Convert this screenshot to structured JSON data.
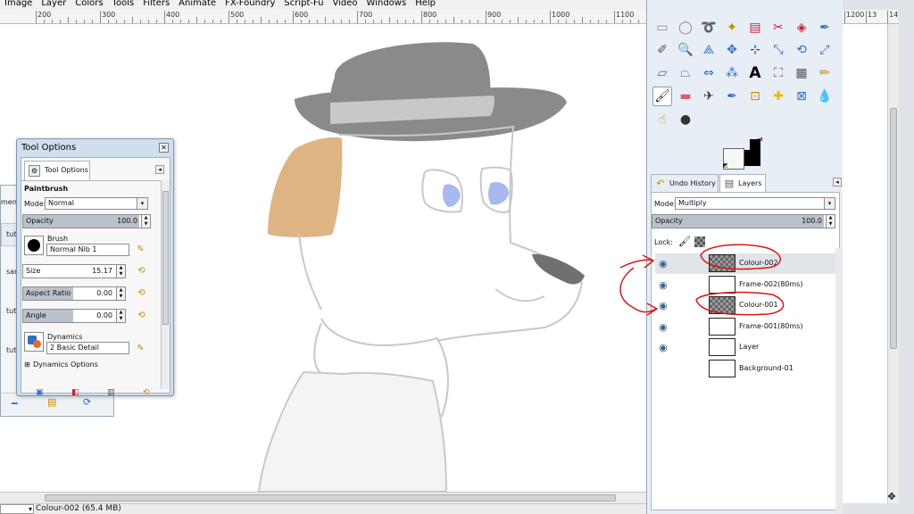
{
  "menu": [
    "Image",
    "Layer",
    "Colors",
    "Tools",
    "Filters",
    "Animate",
    "FX-Foundry",
    "Script-Fu",
    "Video",
    "Windows",
    "Help"
  ],
  "ruler": {
    "labels": [
      "200",
      "300",
      "400",
      "500",
      "600",
      "700",
      "800",
      "900",
      "1000",
      "1100"
    ]
  },
  "right_ruler": {
    "labels": [
      "1200",
      "13",
      "14"
    ]
  },
  "status": {
    "message": "Colour-002 (65.4 MB)"
  },
  "back_window": {
    "snippets": [
      "ment",
      "tuti",
      "san",
      "tuti",
      "tuti"
    ]
  },
  "tool_options": {
    "title": "Tool Options",
    "tab_label": "Tool Options",
    "tool_name": "Paintbrush",
    "mode_label": "Mode:",
    "mode_value": "Normal",
    "opacity_label": "Opacity",
    "opacity_value": "100.0",
    "brush_label": "Brush",
    "brush_value": "Normal Nib 1",
    "size_label": "Size",
    "size_value": "15.17",
    "aspect_label": "Aspect Ratio",
    "aspect_value": "0.00",
    "angle_label": "Angle",
    "angle_value": "0.00",
    "dynamics_label": "Dynamics",
    "dynamics_value": "2 Basic Detail",
    "dynamics_options_label": "Dynamics Options"
  },
  "dock": {
    "tab_undo": "Undo History",
    "tab_layers": "Layers",
    "mode_label": "Mode:",
    "mode_value": "Multiply",
    "opacity_label": "Opacity",
    "opacity_value": "100.0",
    "lock_label": "Lock:"
  },
  "layers": [
    {
      "name": "Colour-002",
      "thumb": "checker",
      "indent": true,
      "visible": true,
      "selected": true
    },
    {
      "name": "Frame-002(80ms)",
      "thumb": "white",
      "indent": true,
      "visible": true,
      "selected": false
    },
    {
      "name": "Colour-001",
      "thumb": "checker",
      "indent": true,
      "visible": true,
      "selected": false
    },
    {
      "name": "Frame-001(80ms)",
      "thumb": "white",
      "indent": true,
      "visible": true,
      "selected": false
    },
    {
      "name": "Layer",
      "thumb": "white",
      "indent": true,
      "visible": true,
      "selected": false
    },
    {
      "name": "Background-01",
      "thumb": "white",
      "indent": true,
      "visible": false,
      "selected": false
    }
  ],
  "colors": {
    "hat": "#8a8a8a",
    "hat_band": "#c8c8c8",
    "ear": "#deb485",
    "eye": "#a9b8ef",
    "nose": "#707070",
    "annotation": "#d21a1a",
    "accent": "#3b5f86"
  }
}
